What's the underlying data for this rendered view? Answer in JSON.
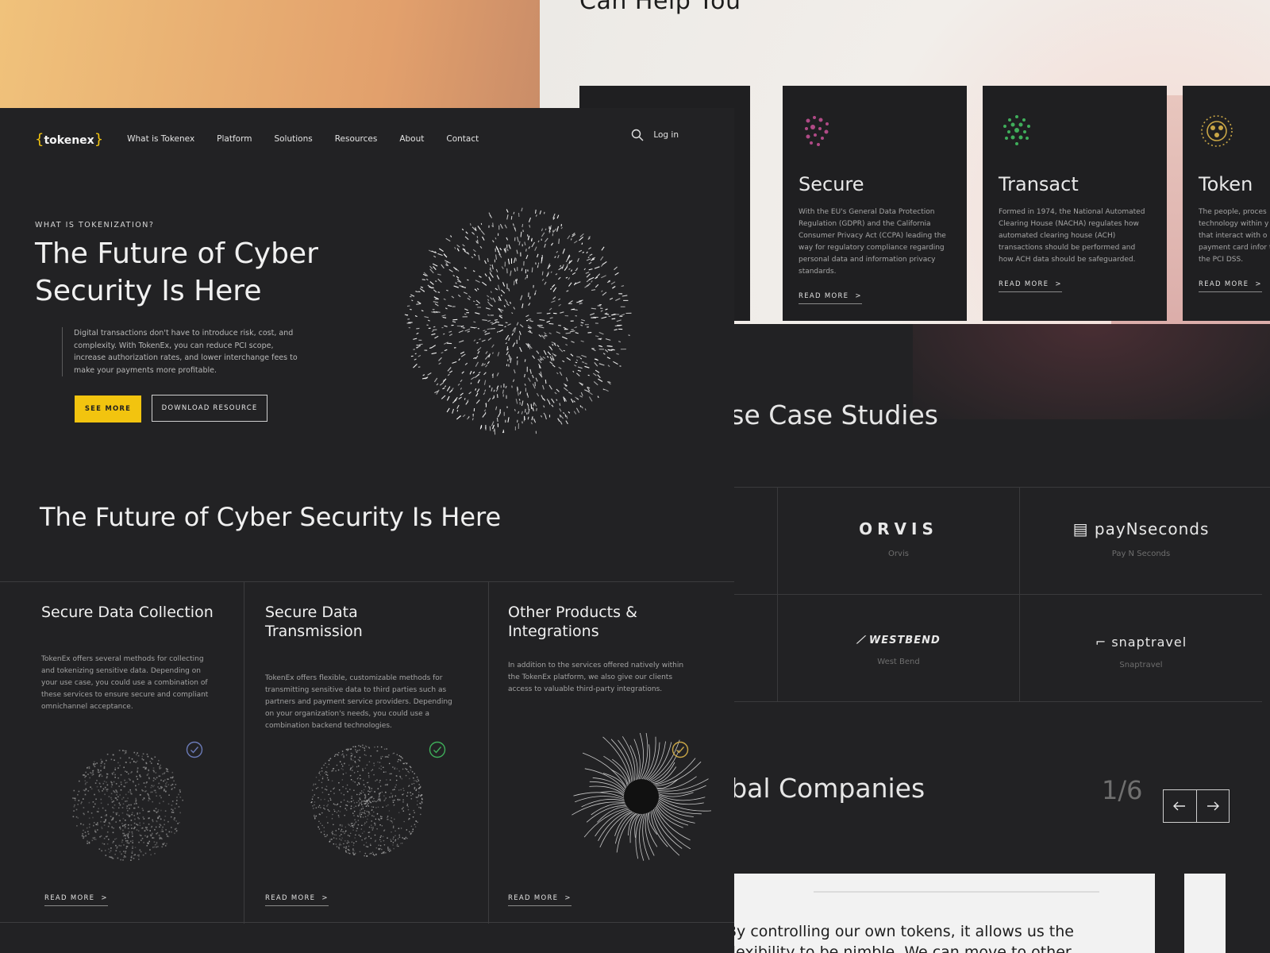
{
  "top": {
    "heading": "Can Help You"
  },
  "nav": {
    "brand": "tokenex",
    "links": [
      "What is Tokenex",
      "Platform",
      "Solutions",
      "Resources",
      "About",
      "Contact"
    ],
    "login": "Log in"
  },
  "hero": {
    "eyebrow": "WHAT IS TOKENIZATION?",
    "title": "The Future of Cyber Security Is Here",
    "copy": "Digital transactions don't have to introduce risk, cost, and complexity. With TokenEx, you can reduce PCI scope, increase authorization rates, and lower interchange fees to make your payments more profitable.",
    "primary_cta": "SEE MORE",
    "secondary_cta": "DOWNLOAD RESOURCE"
  },
  "section": {
    "title": "The Future of Cyber Security Is Here"
  },
  "features": [
    {
      "title": "Secure Data Collection",
      "body": "TokenEx offers several methods for collecting and tokenizing sensitive data. Depending on your use case, you could use a combination of these services to ensure secure and compliant omnichannel acceptance.",
      "cta": "READ MORE"
    },
    {
      "title": "Secure Data Transmission",
      "body": "TokenEx offers flexible, customizable methods for transmitting sensitive data to third parties such as partners and payment service providers. Depending on your organization's needs, you could use a combination backend technologies.",
      "cta": "READ MORE"
    },
    {
      "title": "Other Products & Integrations",
      "body": "In addition to the services offered natively within the TokenEx platform, we also give our clients access to valuable third-party integrations.",
      "cta": "READ MORE"
    }
  ],
  "cards": [
    {
      "title": "Secure",
      "body": "With the EU's General Data Protection Regulation (GDPR) and the California Consumer Privacy Act (CCPA) leading the way for regulatory compliance regarding personal data and information privacy standards.",
      "cta": "READ MORE",
      "icon_color": "#b04a86"
    },
    {
      "title": "Transact",
      "body": "Formed in 1974, the National Automated Clearing House (NACHA) regulates how automated clearing house (ACH) transactions should be performed and how ACH data should be safeguarded.",
      "cta": "READ MORE",
      "icon_color": "#3fae5a"
    },
    {
      "title": "Token",
      "body": "The people, proces technology within y that interact with o payment card infor to the PCI DSS.",
      "cta": "READ MORE",
      "icon_color": "#c9a646"
    }
  ],
  "case_studies": {
    "title": "ese Case Studies",
    "logos": [
      {
        "logo": "ORVIS",
        "caption": "Orvis"
      },
      {
        "logo": "payNseconds",
        "caption": "Pay N Seconds"
      },
      {
        "logo": "WESTBEND",
        "caption": "West Bend"
      },
      {
        "logo": "snaptravel",
        "caption": "Snaptravel"
      }
    ]
  },
  "global": {
    "title": "obal Companies",
    "pager": "1/6",
    "quote": "By controlling our own tokens, it allows us the flexibility to be nimble. We can move to other processors if"
  },
  "colors": {
    "accent": "#f2c40f",
    "panel": "#222224"
  }
}
